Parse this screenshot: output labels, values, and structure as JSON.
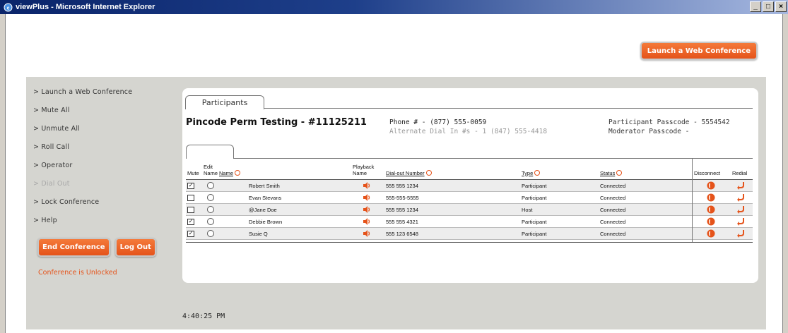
{
  "window": {
    "title": "viewPlus - Microsoft Internet Explorer",
    "buttons": [
      "_",
      "□",
      "×"
    ]
  },
  "header": {
    "launch_button": "Launch a Web Conference"
  },
  "sidebar": {
    "items": [
      {
        "label": "> Launch a Web Conference",
        "enabled": true
      },
      {
        "label": "> Mute All",
        "enabled": true
      },
      {
        "label": "> Unmute All",
        "enabled": true
      },
      {
        "label": "> Roll Call",
        "enabled": true
      },
      {
        "label": "> Operator",
        "enabled": true
      },
      {
        "label": "> Dial Out",
        "enabled": false
      },
      {
        "label": "> Lock Conference",
        "enabled": true
      },
      {
        "label": "> Help",
        "enabled": true
      }
    ],
    "end_button": "End Conference",
    "logout_button": "Log Out",
    "lock_status": "Conference is Unlocked"
  },
  "panel": {
    "tab": "Participants",
    "conference_title": "Pincode Perm Testing - #11125211",
    "phone": "Phone # - (877) 555-0059",
    "alt_dial": "Alternate Dial In #s - 1 (847) 555-4418",
    "participant_passcode": "Participant Passcode - 5554542",
    "moderator_passcode": "Moderator Passcode -"
  },
  "table": {
    "headers": {
      "mute": "Mute",
      "edit": "Edit",
      "name_sub": "Name",
      "name": "Name",
      "playback": "Playback",
      "playback_name": "Name",
      "dialout": "Dial-out Number",
      "type": "Type",
      "status": "Status",
      "disconnect": "Disconnect",
      "redial": "Redial"
    },
    "rows": [
      {
        "muted": true,
        "name": "Robert Smith",
        "number": "555 555 1234",
        "type": "Participant",
        "status": "Connected"
      },
      {
        "muted": false,
        "name": "Evan Stevans",
        "number": "555-555-5555",
        "type": "Participant",
        "status": "Connected"
      },
      {
        "muted": false,
        "name": "@Jane Doe",
        "number": "555 555 1234",
        "type": "Host",
        "status": "Connected"
      },
      {
        "muted": true,
        "name": "Debbie Brown",
        "number": "555 555 4321",
        "type": "Participant",
        "status": "Connected"
      },
      {
        "muted": true,
        "name": "Susie Q",
        "number": "555 123 6548",
        "type": "Participant",
        "status": "Connected"
      }
    ]
  },
  "clock": "4:40:25 PM",
  "colors": {
    "accent": "#e5531a",
    "background": "#d5d5d0",
    "titlebar": "#0a246a"
  },
  "icons": {
    "playback": "speaker-icon",
    "disconnect": "disconnect-icon",
    "redial": "redial-arrow-icon",
    "sort": "sort-icon"
  }
}
